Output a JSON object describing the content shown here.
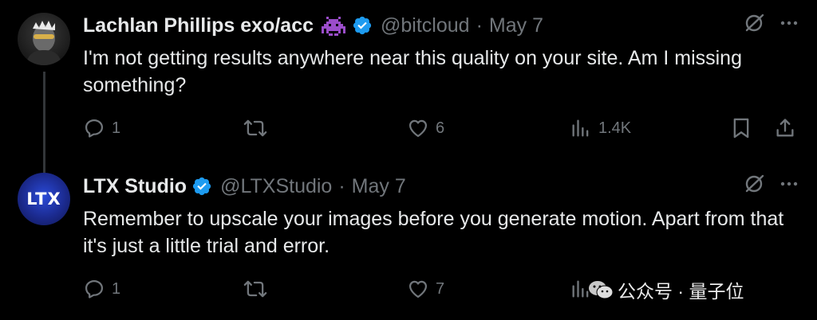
{
  "tweets": [
    {
      "author_name": "Lachlan Phillips exo/acc",
      "emoji_icon": "space-invader-icon",
      "verified": true,
      "handle": "@bitcloud",
      "separator": "·",
      "date": "May 7",
      "text": "I'm not getting results anywhere near this quality on your site. Am I missing something?",
      "replies": "1",
      "retweets": "",
      "likes": "6",
      "views": "1.4K"
    },
    {
      "author_name": "LTX Studio",
      "avatar_text": "LTX",
      "verified": true,
      "handle": "@LTXStudio",
      "separator": "·",
      "date": "May 7",
      "text": "Remember to upscale your images before you generate motion. Apart from that it's just a little trial and error.",
      "replies": "1",
      "retweets": "",
      "likes": "7",
      "views": ""
    }
  ],
  "watermark": {
    "text": "公众号 · 量子位",
    "icon": "wechat-icon"
  },
  "colors": {
    "background": "#000000",
    "text_primary": "#e7e9ea",
    "text_secondary": "#71767b",
    "verified_badge": "#1d9bf0",
    "emoji_purple": "#9b4dca",
    "ltx_avatar": "#2440c8"
  }
}
